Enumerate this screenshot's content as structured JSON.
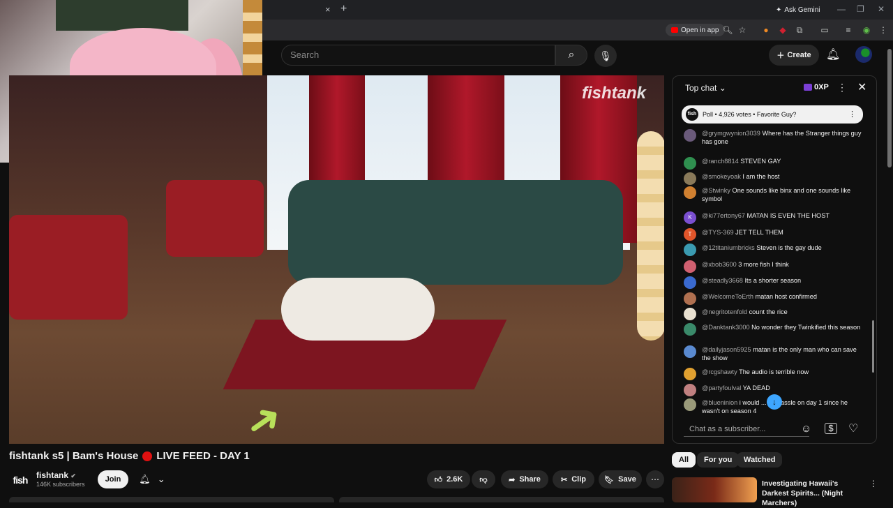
{
  "browser": {
    "tab_close": "×",
    "new_tab": "+",
    "gemini_label": "Ask Gemini",
    "open_in_app": "Open in app",
    "window_controls": [
      "—",
      "❐",
      "✕"
    ]
  },
  "header": {
    "search_placeholder": "Search",
    "create_label": "Create"
  },
  "video": {
    "watermark": "fishtank",
    "title": "fishtank s5 | Bam's House",
    "live_text": "LIVE FEED - DAY 1"
  },
  "channel": {
    "logo_text": "fish",
    "name": "fishtank",
    "subscribers": "146K subscribers",
    "join_label": "Join"
  },
  "actions": {
    "likes": "2.6K",
    "share": "Share",
    "clip": "Clip",
    "save": "Save"
  },
  "chat": {
    "mode": "Top chat",
    "xp": "0XP",
    "poll_text": "Poll • 4,926 votes • Favorite Guy?",
    "poll_logo": "fish",
    "input_placeholder": "Chat as a subscriber...",
    "messages": [
      {
        "author": "@grymgwynion3039",
        "text": "Where has the Stranger things guy has gone",
        "color": "#6a5a7a",
        "initial": ""
      },
      {
        "author": "@ranch8814",
        "text": "STEVEN GAY",
        "color": "#2f8f4f",
        "initial": ""
      },
      {
        "author": "@smokeyoak",
        "text": "I am the host",
        "color": "#8a7a5a",
        "initial": ""
      },
      {
        "author": "@Stwinky",
        "text": "One sounds like binx and one sounds like symbol",
        "color": "#d08030",
        "initial": ""
      },
      {
        "author": "@ki77ertony67",
        "text": "MATAN IS EVEN THE HOST",
        "color": "#7a4fd0",
        "initial": "K"
      },
      {
        "author": "@TYS-369",
        "text": "JET TELL THEM",
        "color": "#e0552a",
        "initial": "T"
      },
      {
        "author": "@12titaniumbricks",
        "text": "Steven is the gay dude",
        "color": "#3a9ab0",
        "initial": ""
      },
      {
        "author": "@xbob3600",
        "text": "3 more fish I think",
        "color": "#d06070",
        "initial": ""
      },
      {
        "author": "@steadly3668",
        "text": "Its a shorter season",
        "color": "#3a6ad0",
        "initial": ""
      },
      {
        "author": "@WelcomeToErth",
        "text": "matan host confirmed",
        "color": "#b07050",
        "initial": ""
      },
      {
        "author": "@negritotenfold",
        "text": "count the rice",
        "color": "#e8e0d0",
        "initial": ""
      },
      {
        "author": "@Danktank3000",
        "text": "No wonder they Twinkified this season",
        "color": "#3a8a6a",
        "initial": ""
      },
      {
        "author": "@dailyjason5925",
        "text": "matan is the only man who can save the show",
        "color": "#5a8ad0",
        "initial": ""
      },
      {
        "author": "@rcgshawty",
        "text": "The audio is terrible now",
        "color": "#e0a030",
        "initial": ""
      },
      {
        "author": "@partyfoulval",
        "text": "YA DEAD",
        "color": "#c08080",
        "initial": ""
      },
      {
        "author": "@blueninion",
        "text": "i would ... nd hassle on day 1 since he wasn't on season 4",
        "color": "#9a9a7a",
        "initial": ""
      }
    ]
  },
  "filters": [
    "All",
    "For you",
    "Watched"
  ],
  "recommended": {
    "title": "Investigating Hawaii's Darkest Spirits... (Night Marchers)"
  },
  "colors": {
    "accent_red": "#ff0000",
    "live_dot": "#e01010",
    "link_blue": "#3ea6ff",
    "arrow_green": "#b8e05a"
  }
}
